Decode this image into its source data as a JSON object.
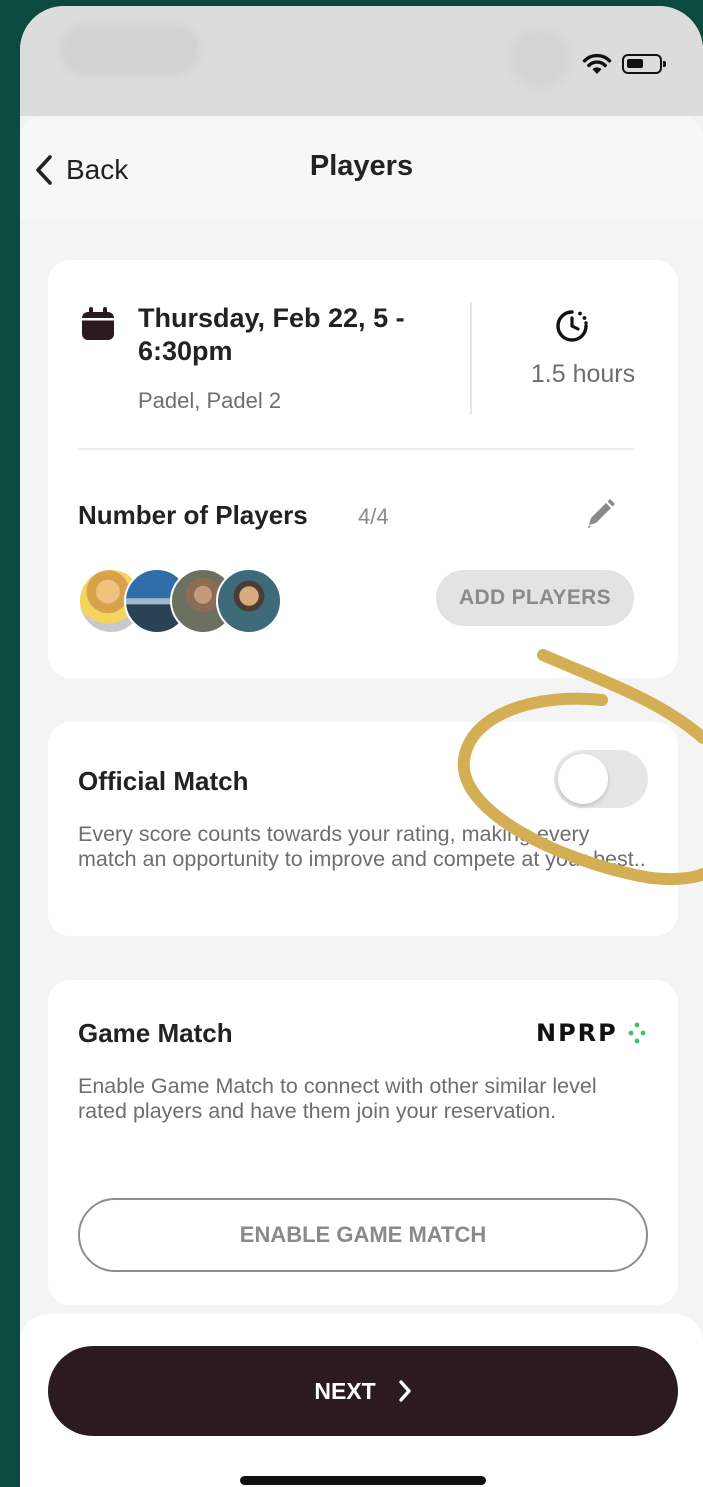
{
  "nav": {
    "back_label": "Back",
    "title": "Players"
  },
  "reservation": {
    "date_time": "Thursday, Feb 22, 5 - 6:30pm",
    "venue": "Padel, Padel 2",
    "duration": "1.5 hours"
  },
  "players": {
    "title": "Number of Players",
    "count": "4/4",
    "add_label": "ADD PLAYERS"
  },
  "official_match": {
    "title": "Official Match",
    "enabled": false,
    "description": "Every score counts towards your rating, making every match an opportunity to improve and compete at your best.."
  },
  "game_match": {
    "title": "Game Match",
    "brand": "NPRP",
    "description": "Enable Game Match to connect with other similar level rated players and have them join your reservation.",
    "button_label": "ENABLE GAME MATCH"
  },
  "footer": {
    "next_label": "NEXT"
  },
  "colors": {
    "background": "#0b4a3e",
    "primary_button": "#2b1a1f",
    "annotation": "#d4ae55",
    "brand_accent": "#3fbf6f"
  },
  "icons": [
    "wifi-icon",
    "battery-icon",
    "chevron-left-icon",
    "calendar-icon",
    "clock-icon",
    "pencil-icon",
    "chevron-right-icon",
    "nprp-logo-icon"
  ]
}
